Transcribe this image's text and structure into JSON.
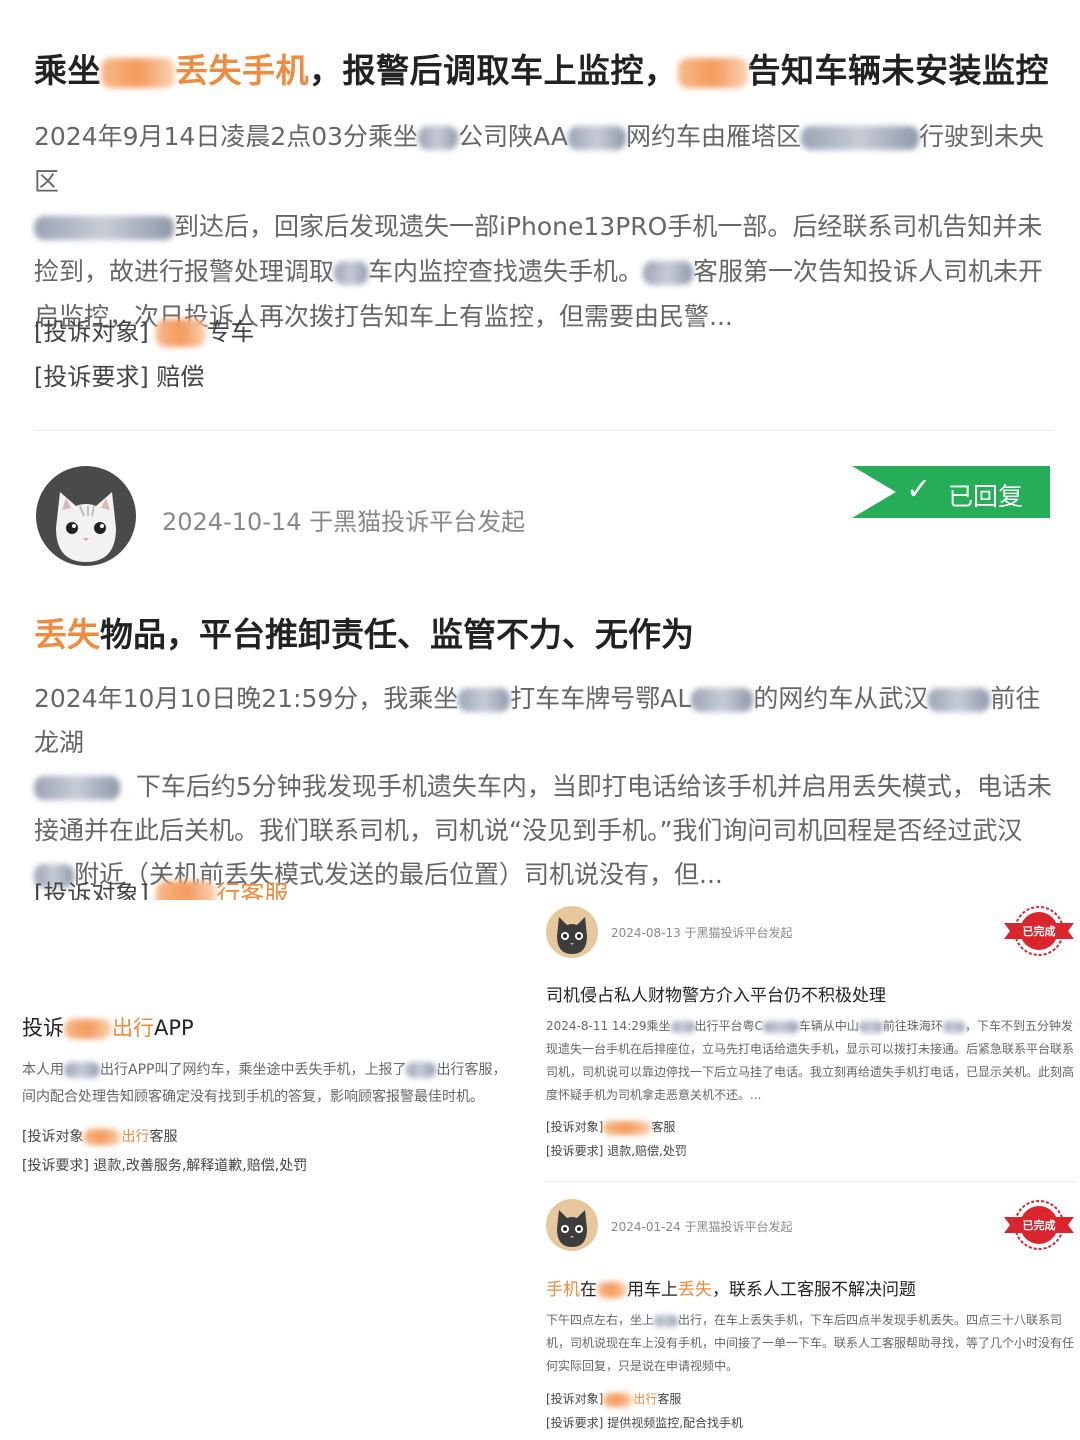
{
  "card1": {
    "title_parts": [
      "乘坐",
      "丢失手机",
      "，报警后调取车上监控，",
      "告知车辆未安装监控"
    ],
    "body_parts": [
      "2024年9月14日凌晨2点03分乘坐",
      "公司陕AA",
      "网约车由雁塔区",
      "行驶到未央区",
      "到达后，回家后发现遗失一部iPhone13PRO手机一部。后经联系司机告知并未捡到，故进行报警处理调取",
      "车内监控查找遗失手机。",
      "客服第一次告知投诉人司机未开启监控，次日投诉人再次拨打告知车上有监控，但需要由民警..."
    ],
    "target_label": "[投诉对象]",
    "target_value": "专车",
    "req_label": "[投诉要求]",
    "req_value": "赔偿"
  },
  "card2": {
    "meta": "2024-10-14 于黑猫投诉平台发起",
    "status": "已回复",
    "title_highlight": "丢失",
    "title_rest": "物品，平台推卸责任、监管不力、无作为",
    "body_parts": [
      "2024年10月10日晚21:59分，我乘坐",
      "打车车牌号鄂AL",
      "的网约车从武汉",
      "前往龙湖",
      "下车后约5分钟我发现手机遗失车内，当即打电话给该手机并启用丢失模式，电话未接通并在此后关机。我们联系司机，司机说“没见到手机。”我们询问司机回程是否经过武汉",
      "附近（关机前丢失模式发送的最后位置）司机说没有，但..."
    ],
    "target_label": "[投诉对象]",
    "target_mid": "行",
    "target_value": "客服"
  },
  "left_card": {
    "title_pre": "投诉",
    "title_mid": "出行",
    "title_end": "APP",
    "body_parts": [
      "本人用",
      "出行APP叫了网约车，乘坐途中丢失手机，上报了",
      "出行客服，",
      "间内配合处理告知顾客确定没有找到手机的答复，影响顾客报警最佳时机。"
    ],
    "target_label": "[投诉对象",
    "target_mid": "出行",
    "target_value": "客服",
    "req_label": "[投诉要求]",
    "req_value": "退款,改善服务,解释道歉,赔偿,处罚"
  },
  "right_card1": {
    "meta": "2024-08-13 于黑猫投诉平台发起",
    "stamp": "已完成",
    "title": "司机侵占私人财物警方介入平台仍不积极处理",
    "body_parts": [
      "2024-8-11 14:29乘坐",
      "出行平台粤C",
      "车辆从中山",
      "前往珠海环",
      "，下车不到五分钟发现遗失一台手机在后排座位，立马先打电话给遗失手机，显示可以拨打未接通。后紧急联系平台联系司机，司机说可以靠边停找一下后立马挂了电话。我立刻再给遗失手机打电话，已显示关机。此刻高度怀疑手机为司机拿走恶意关机不还。..."
    ],
    "target_label": "[投诉对象]",
    "target_value": "客服",
    "req_label": "[投诉要求]",
    "req_value": "退款,赔偿,处罚"
  },
  "right_card2": {
    "meta": "2024-01-24 于黑猫投诉平台发起",
    "stamp": "已完成",
    "title_a": "手机",
    "title_b": "在",
    "title_c": "用车上",
    "title_d": "丢失",
    "title_e": "，联系人工客服不解决问题",
    "body_parts": [
      "下午四点左右，坐上",
      "出行，在车上丢失手机，下车后四点半发现手机丢失。四点三十八联系司机，司机说现在车上没有手机，中间接了一单一下车。联系人工客服帮助寻找，等了几个小时没有任何实际回复，只是说在申请视频中。"
    ],
    "target_label": "[投诉对象]",
    "target_mid": "出行",
    "target_value": "客服",
    "req_label": "[投诉要求]",
    "req_value": "提供视频监控,配合找手机"
  },
  "colors": {
    "accent_orange": "#f08a3c",
    "replied_green": "#26ad57",
    "stamp_red": "#d9252b"
  }
}
